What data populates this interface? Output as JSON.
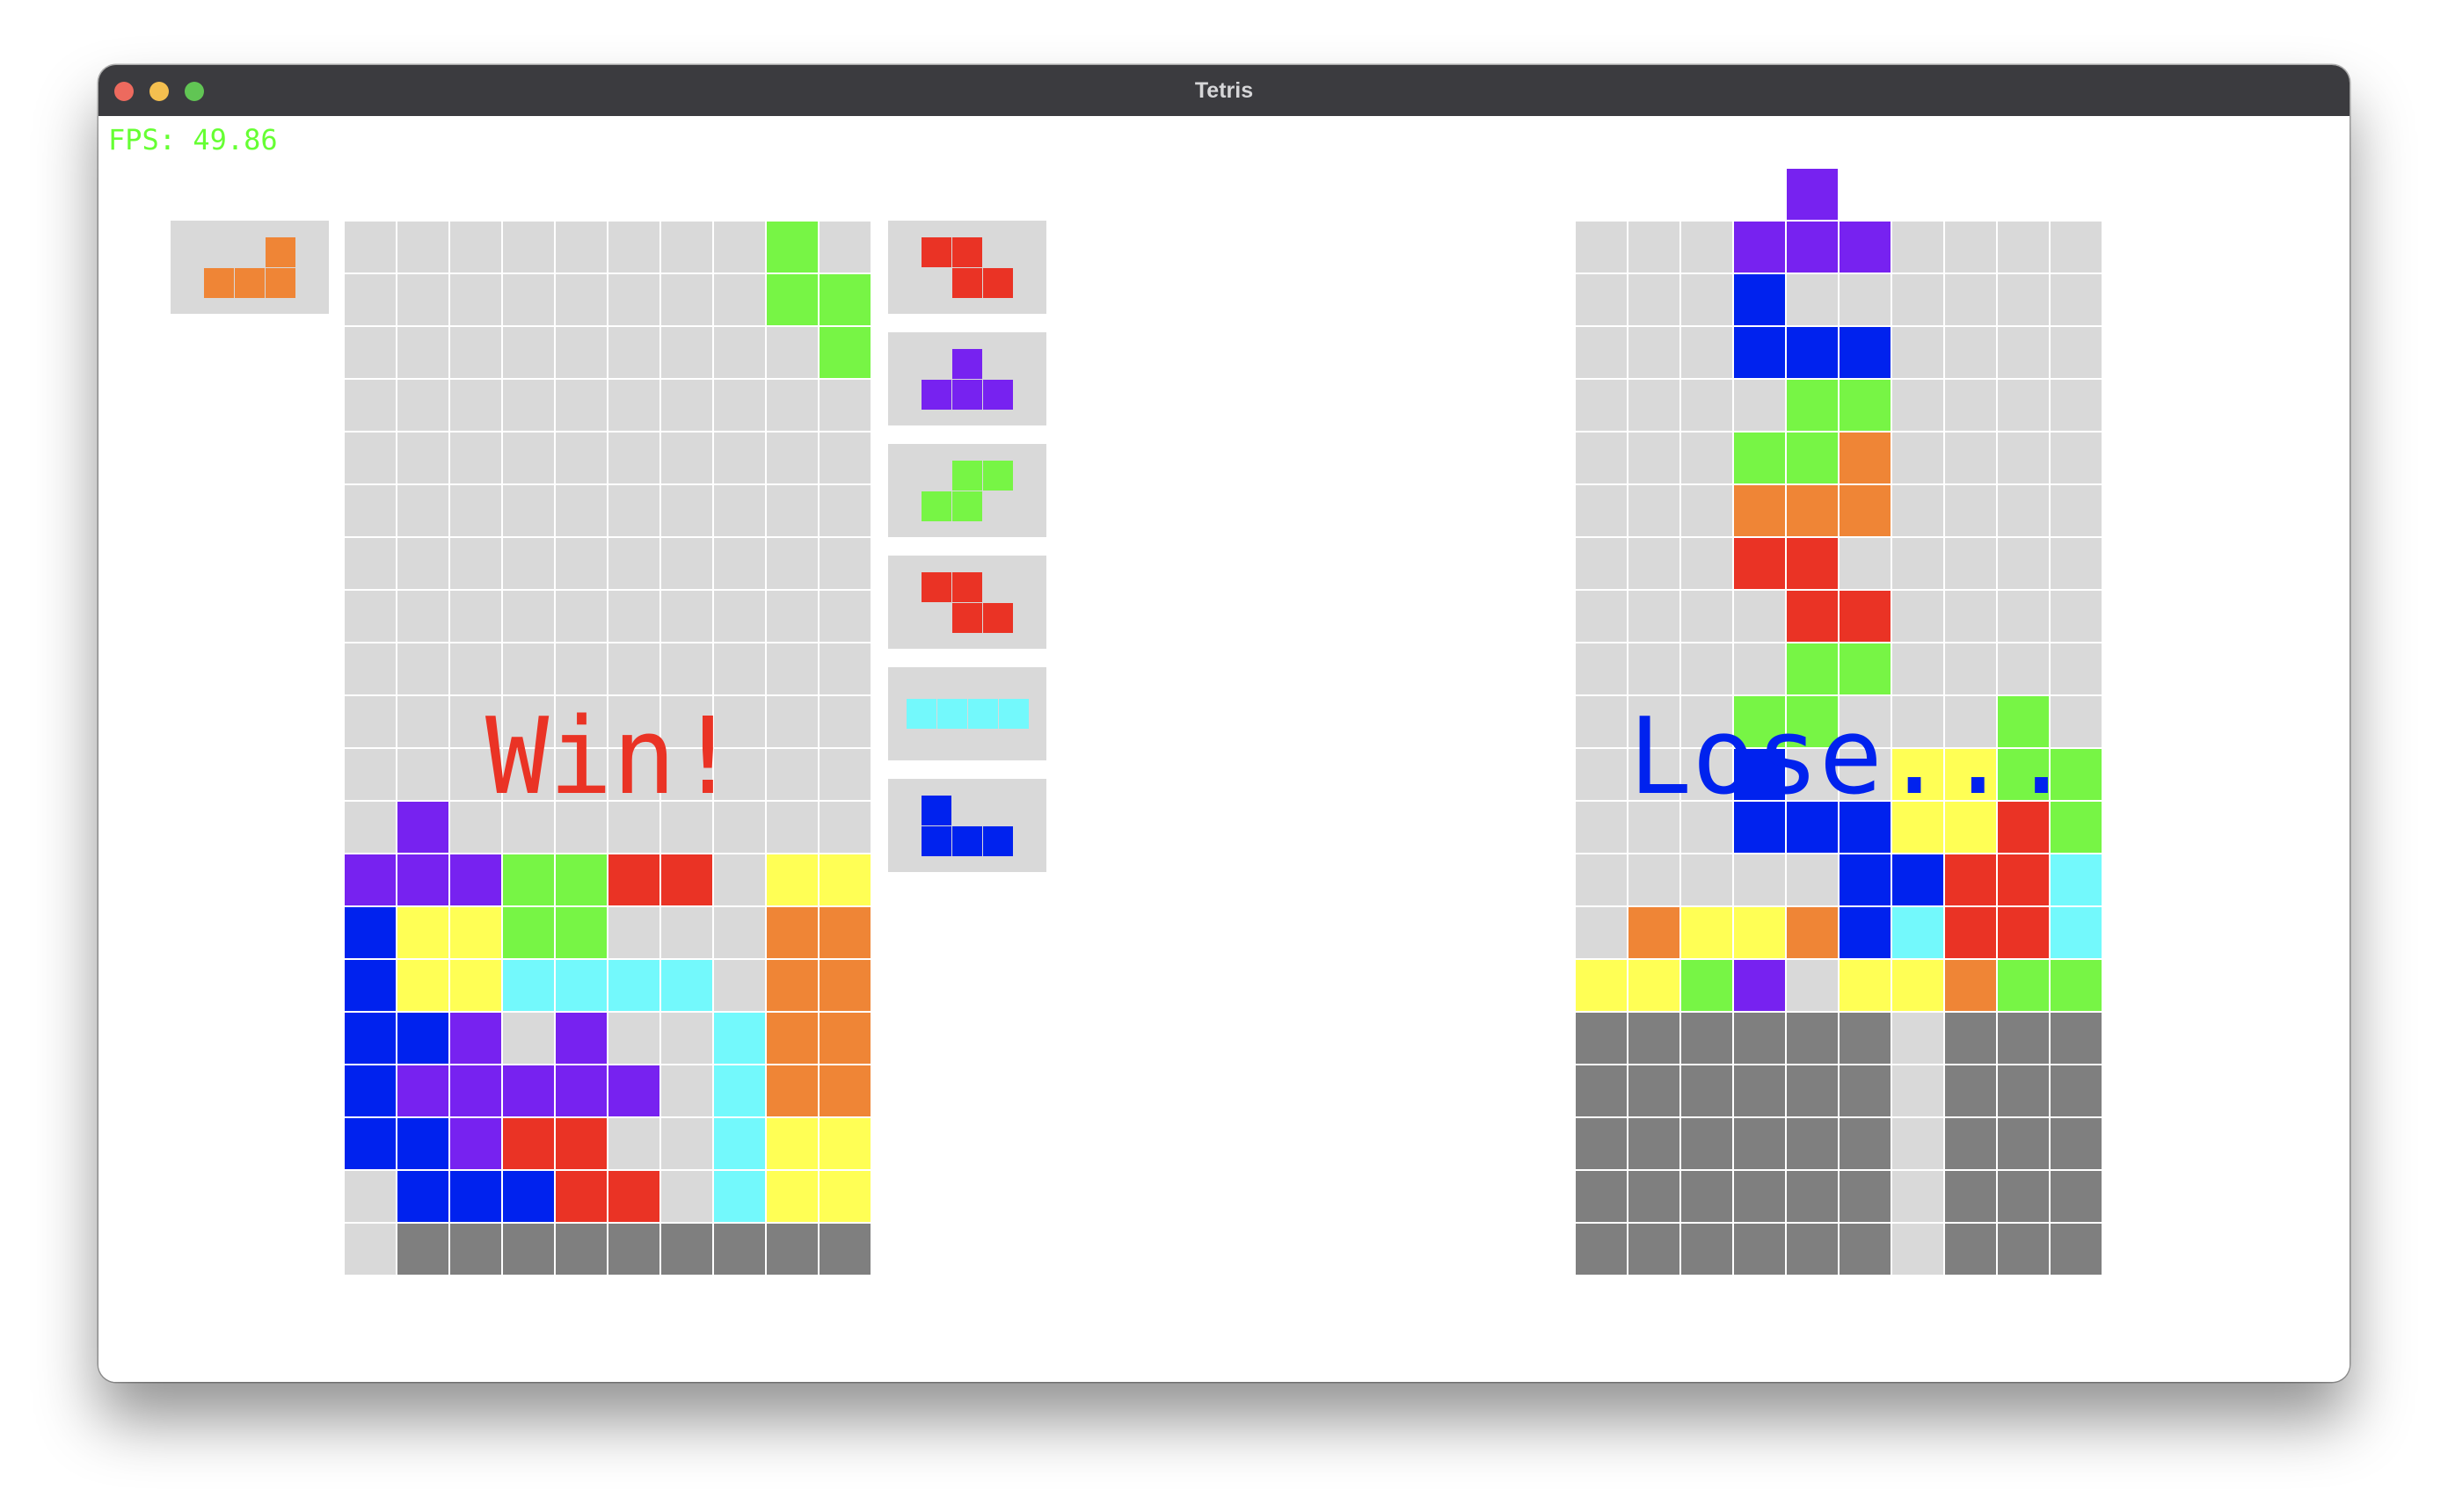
{
  "window": {
    "title": "Tetris"
  },
  "hud": {
    "fps": "FPS: 49.86"
  },
  "colors": {
    "empty": "#d9d9d9",
    "garbage": "#7f7f7f",
    "grid": "#ffffff",
    "win_text": "#ea3325",
    "lose_text": "#0022ee",
    "traffic_red": "#ed6a5e",
    "traffic_yellow": "#f4bf4f",
    "traffic_green": "#61c554"
  },
  "palette": {
    ".": "#d9d9d9",
    "P": "#7722f0",
    "B": "#0022ee",
    "G": "#77f545",
    "R": "#ea3325",
    "Y": "#ffff55",
    "O": "#ef8536",
    "C": "#73f9fc",
    "X": "#7f7f7f"
  },
  "legend": {
    ".": "empty",
    "P": "T (purple)",
    "B": "J (blue)",
    "G": "S (green)",
    "R": "Z (red)",
    "Y": "O (yellow)",
    "O": "L (orange)",
    "C": "I (cyan)",
    "X": "garbage"
  },
  "player1": {
    "message": "Win!",
    "hold_piece": "L",
    "next_queue": [
      "Z",
      "T",
      "S",
      "Z",
      "I",
      "J"
    ],
    "board": [
      "........G.",
      "........GG",
      ".........G",
      "..........",
      "..........",
      "..........",
      "..........",
      "..........",
      "..........",
      "..........",
      "..........",
      ".P........",
      "PPPGGRR.YY",
      "BYYGG...OO",
      "BYYCCCC.OO",
      "BBP.P..COO",
      "BPPPPP.COO",
      "BBPRR..CYY",
      ".BBBRR.CYY",
      ".XXXXXXXXX"
    ]
  },
  "player2": {
    "message": "Lose...",
    "overflow_row": "....P.....",
    "board": [
      "...PPP....",
      "...B......",
      "...BBB....",
      "....GG....",
      "...GGO....",
      "...OOO....",
      "...RR.....",
      "....RR....",
      "....GG....",
      "...GG...G.",
      "...B..YYGG",
      "...BBBYYRG",
      ".....BBRRC",
      ".OYYOBCRRC",
      "YYGP.YYOGG",
      "XXXXXX.XXX",
      "XXXXXX.XXX",
      "XXXXXX.XXX",
      "XXXXXX.XXX",
      "XXXXXX.XXX"
    ]
  },
  "pieces": {
    "L": [
      "..O",
      "OOO"
    ],
    "Z": [
      "RR.",
      ".RR"
    ],
    "T": [
      ".P.",
      "PPP"
    ],
    "S": [
      ".GG",
      "GG."
    ],
    "I": [
      "CCCC"
    ],
    "J": [
      "B..",
      "BBB"
    ],
    "O": [
      "YY",
      "YY"
    ]
  }
}
